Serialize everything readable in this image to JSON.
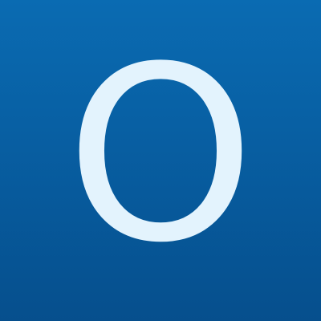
{
  "letter": "O",
  "colors": {
    "background_top": "#0a6bb2",
    "background_bottom": "#064f8d",
    "letter": "#e3f3fd"
  }
}
